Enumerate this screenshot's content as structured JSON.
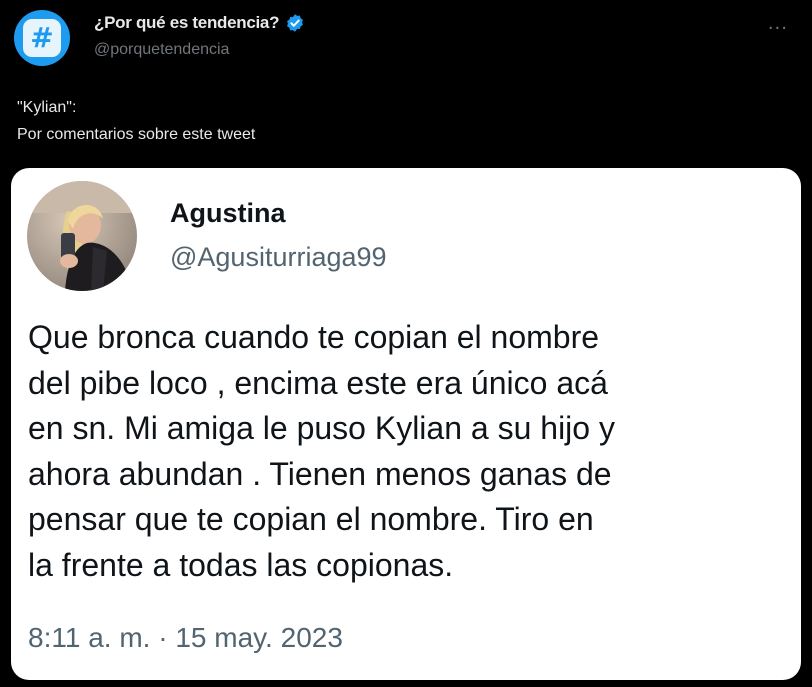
{
  "account": {
    "name": "¿Por qué es tendencia?",
    "handle": "@porquetendencia",
    "avatar_icon": "hashtag-icon",
    "avatar_glyph": "#",
    "verified_icon": "verified-badge-icon",
    "more_icon": "more-options-icon",
    "more_glyph": "···"
  },
  "trend": {
    "topic": "\"Kylian\":",
    "reason": "Por comentarios sobre este tweet"
  },
  "quoted_tweet": {
    "author_name": "Agustina",
    "author_handle": "@Agusiturriaga99",
    "text": "Que bronca cuando te copian el nombre\ndel pibe loco , encima este era único acá\nen sn. Mi amiga le puso Kylian a su hijo y\nahora abundan . Tienen menos ganas de\npensar que te copian el nombre. Tiro en\nla frente a todas las copionas.",
    "timestamp": "8:11 a. m. · 15 may. 2023"
  },
  "colors": {
    "background": "#000000",
    "brand_blue": "#1d9bf0",
    "primary_text_dark": "#e7e9ea",
    "secondary_text": "#71767b",
    "card_background": "#ffffff",
    "card_text": "#0f1419",
    "card_secondary_text": "#536471"
  }
}
